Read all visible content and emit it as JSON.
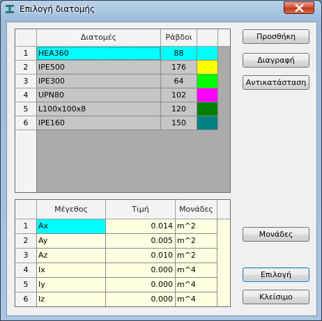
{
  "window": {
    "title": "Επιλογή διατομής"
  },
  "sections_grid": {
    "headers": [
      "Διατομές",
      "Ράβδοι"
    ],
    "rows": [
      {
        "num": "1",
        "name": "HEA360",
        "count": "88",
        "color": "#00ffff"
      },
      {
        "num": "2",
        "name": "IPE500",
        "count": "176",
        "color": "#ffff00"
      },
      {
        "num": "3",
        "name": "IPE300",
        "count": "64",
        "color": "#00ff00"
      },
      {
        "num": "4",
        "name": "UPN80",
        "count": "102",
        "color": "#ff00ff"
      },
      {
        "num": "5",
        "name": "L100x100x8",
        "count": "120",
        "color": "#008000"
      },
      {
        "num": "6",
        "name": "IPE160",
        "count": "150",
        "color": "#008080"
      }
    ]
  },
  "properties_grid": {
    "headers": [
      "Μέγεθος",
      "Τιμή",
      "Μονάδες"
    ],
    "rows": [
      {
        "num": "1",
        "name": "Ax",
        "value": "0.014",
        "unit": "m^2"
      },
      {
        "num": "2",
        "name": "Ay",
        "value": "0.005",
        "unit": "m^2"
      },
      {
        "num": "3",
        "name": "Az",
        "value": "0.010",
        "unit": "m^2"
      },
      {
        "num": "4",
        "name": "Ix",
        "value": "0.000",
        "unit": "m^4"
      },
      {
        "num": "5",
        "name": "Iy",
        "value": "0.000",
        "unit": "m^4"
      },
      {
        "num": "6",
        "name": "Iz",
        "value": "0.000",
        "unit": "m^4"
      }
    ]
  },
  "buttons": {
    "add": "Προσθήκη",
    "delete": "Διαγραφή",
    "replace": "Αντικατάσταση",
    "units": "Μονάδες",
    "select": "Επιλογή",
    "close": "Κλείσιμο"
  },
  "colors": {
    "selection": "#00ffff",
    "property_cell": "#ffffe1",
    "grid_cell": "#c6c6c6"
  },
  "icons": {
    "app": "steel-section-icon",
    "close": "close-icon"
  }
}
